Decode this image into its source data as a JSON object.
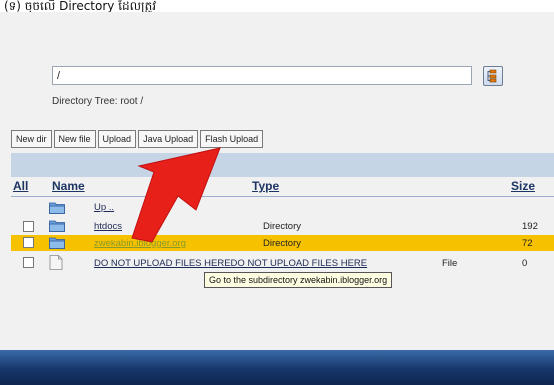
{
  "top_caption": "(ទ) ចុចលើ Directory ដែលត្រូវ",
  "path": {
    "value": "/"
  },
  "directory_tree": "Directory Tree: root /",
  "toolbar": {
    "buttons": [
      "New dir",
      "New file",
      "Upload",
      "Java Upload",
      "Flash Upload"
    ]
  },
  "table": {
    "headers": {
      "all": "All",
      "name": "Name",
      "type": "Type",
      "size": "Size"
    },
    "rows": [
      {
        "name": "Up ..",
        "type": "",
        "size": "",
        "checkbox": false,
        "icon": "folder-up-icon",
        "selected": false
      },
      {
        "name": "htdocs",
        "type": "Directory",
        "size": "192",
        "checkbox": true,
        "icon": "folder-icon",
        "selected": false
      },
      {
        "name": "zwekabin.iblogger.org",
        "type": "Directory",
        "size": "72",
        "checkbox": true,
        "icon": "folder-icon",
        "selected": true
      },
      {
        "name": "DO NOT UPLOAD FILES HEREDO NOT UPLOAD FILES HERE",
        "type": "File",
        "size": "0",
        "checkbox": true,
        "icon": "file-icon",
        "selected": false
      }
    ]
  },
  "tooltip": "Go to the subdirectory zwekabin.iblogger.org",
  "colors": {
    "selected_row": "#f6c200",
    "header_strip": "#c6d5e6",
    "annotation_arrow": "#e8201a",
    "footer": "#17366b"
  }
}
